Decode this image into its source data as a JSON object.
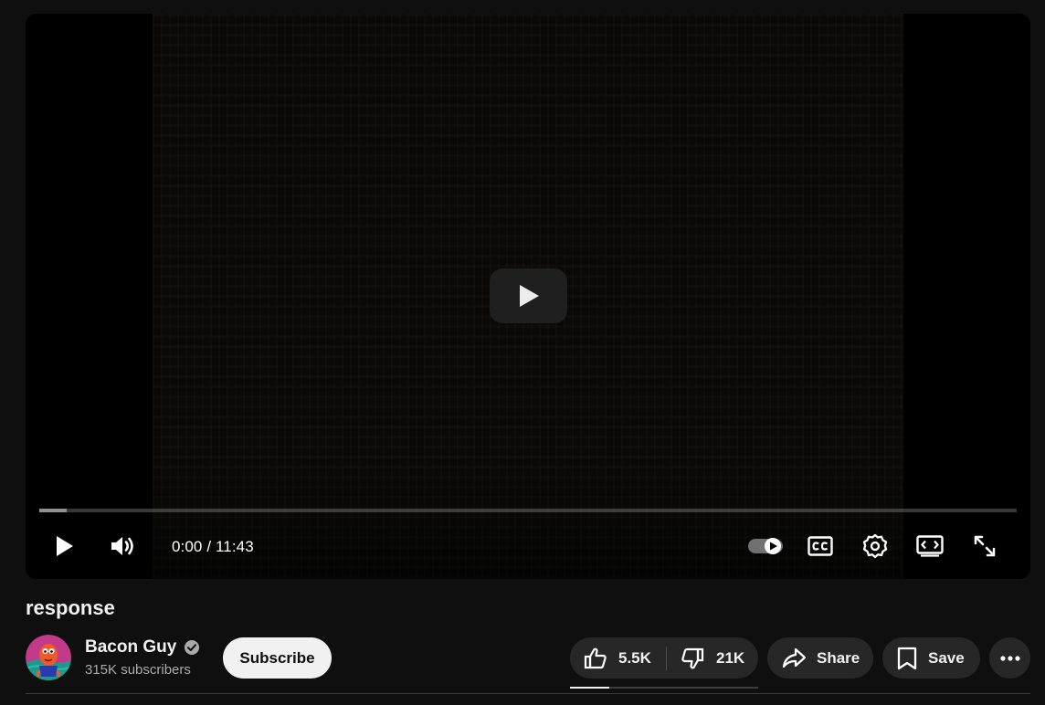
{
  "player": {
    "current_time": "0:00",
    "separator": " / ",
    "duration": "11:43",
    "progress_fraction": 0.0,
    "buffered_fraction": 0.028,
    "icons": [
      "play-icon",
      "volume-icon",
      "autoplay-toggle",
      "cc-icon",
      "settings-gear-icon",
      "theater-mode-icon",
      "fullscreen-icon"
    ]
  },
  "video": {
    "title": "response"
  },
  "channel": {
    "name": "Bacon Guy",
    "verified": true,
    "subscribers": "315K subscribers"
  },
  "actions": {
    "subscribe_label": "Subscribe",
    "likes": "5.5K",
    "dislikes": "21K",
    "like_ratio": 0.21,
    "share_label": "Share",
    "save_label": "Save"
  },
  "colors": {
    "background": "#0f0f0f",
    "pill": "#272727",
    "text": "#f1f1f1",
    "secondary_text": "#aaaaaa",
    "subscribe_bg": "#f1f1f1"
  }
}
